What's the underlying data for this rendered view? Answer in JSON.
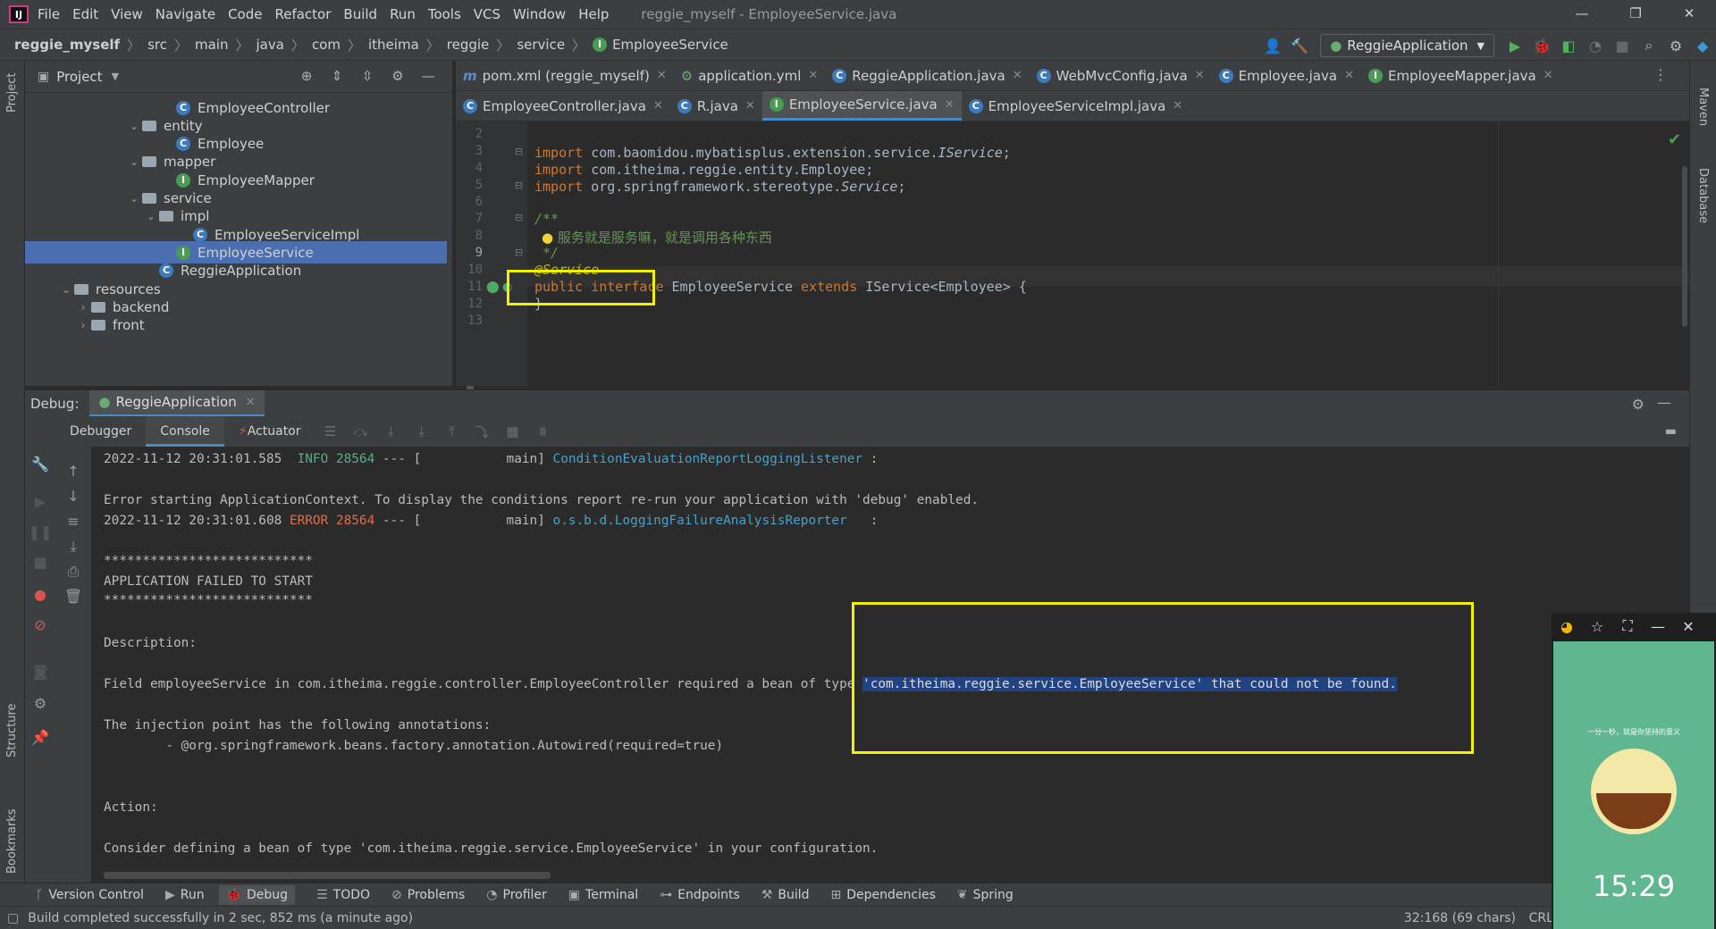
{
  "app": {
    "window_title": "reggie_myself - EmployeeService.java",
    "menu": [
      "File",
      "Edit",
      "View",
      "Navigate",
      "Code",
      "Refactor",
      "Build",
      "Run",
      "Tools",
      "VCS",
      "Window",
      "Help"
    ]
  },
  "breadcrumb": [
    "reggie_myself",
    "src",
    "main",
    "java",
    "com",
    "itheima",
    "reggie",
    "service",
    "EmployeeService"
  ],
  "run_config": "ReggieApplication",
  "project": {
    "title": "Project",
    "tree": [
      {
        "label": "EmployeeController",
        "icon": "class-icon",
        "indent": 9
      },
      {
        "label": "entity",
        "icon": "folder-icon",
        "indent": 7,
        "expanded": true
      },
      {
        "label": "Employee",
        "icon": "class-icon",
        "indent": 9
      },
      {
        "label": "mapper",
        "icon": "folder-icon",
        "indent": 7,
        "expanded": true
      },
      {
        "label": "EmployeeMapper",
        "icon": "interface-icon",
        "indent": 9
      },
      {
        "label": "service",
        "icon": "folder-icon",
        "indent": 7,
        "expanded": true
      },
      {
        "label": "impl",
        "icon": "folder-icon",
        "indent": 8,
        "expanded": true
      },
      {
        "label": "EmployeeServiceImpl",
        "icon": "class-icon",
        "indent": 10
      },
      {
        "label": "EmployeeService",
        "icon": "interface-icon",
        "indent": 9,
        "selected": true
      },
      {
        "label": "ReggieApplication",
        "icon": "class-icon",
        "indent": 8
      },
      {
        "label": "resources",
        "icon": "folder-icon",
        "indent": 3,
        "expanded": true
      },
      {
        "label": "backend",
        "icon": "folder-icon",
        "indent": 4,
        "collapsed": true
      },
      {
        "label": "front",
        "icon": "folder-icon",
        "indent": 4,
        "collapsed": true
      }
    ]
  },
  "editor": {
    "tabs_row1": [
      {
        "label": "pom.xml (reggie_myself)",
        "icon": "m"
      },
      {
        "label": "application.yml",
        "icon": "y"
      },
      {
        "label": "ReggieApplication.java",
        "icon": "c"
      },
      {
        "label": "WebMvcConfig.java",
        "icon": "c"
      },
      {
        "label": "Employee.java",
        "icon": "c"
      },
      {
        "label": "EmployeeMapper.java",
        "icon": "i"
      }
    ],
    "tabs_row2": [
      {
        "label": "EmployeeController.java",
        "icon": "c"
      },
      {
        "label": "R.java",
        "icon": "c"
      },
      {
        "label": "EmployeeService.java",
        "icon": "i",
        "active": true
      },
      {
        "label": "EmployeeServiceImpl.java",
        "icon": "c"
      }
    ],
    "line_numbers": [
      "2",
      "3",
      "4",
      "5",
      "6",
      "7",
      "8",
      "9",
      "10",
      "11",
      "12",
      "13"
    ],
    "code": {
      "l3_kw": "import ",
      "l3_pkg": "com.baomidou.mybatisplus.extension.service.",
      "l3_cls": "IService",
      "l3_end": ";",
      "l4_kw": "import ",
      "l4_rest": "com.itheima.reggie.entity.Employee;",
      "l5_kw": "import ",
      "l5_pkg": "org.springframework.stereotype.",
      "l5_cls": "Service",
      "l5_end": ";",
      "l7": "/**",
      "l8": "服务就是服务嘛，就是调用各种东西",
      "l9": " */",
      "l10": "@Service",
      "l11_kw1": "public interface ",
      "l11_name": "EmployeeService ",
      "l11_kw2": "extends ",
      "l11_rest": "IService<Employee> {",
      "l12": "}"
    }
  },
  "debug": {
    "label": "Debug:",
    "session_tab": "ReggieApplication",
    "tabs": [
      "Debugger",
      "Console",
      "Actuator"
    ],
    "console": {
      "l1_time": "2022-11-12 20:31:01.585  ",
      "l1_level": "INFO 28564",
      "l1_mid": " --- [           main] ",
      "l1_logger": "ConditionEvaluationReportLoggingListener",
      "l1_end": " :",
      "l2": "Error starting ApplicationContext. To display the conditions report re-run your application with 'debug' enabled.",
      "l3_time": "2022-11-12 20:31:01.608 ",
      "l3_level": "ERROR 28564",
      "l3_mid": " --- [           main] ",
      "l3_logger": "o.s.b.d.LoggingFailureAnalysisReporter",
      "l3_end": "   :",
      "stars": "***************************",
      "failed": "APPLICATION FAILED TO START",
      "desc": "Description:",
      "field_pre": "Field employeeService in com.itheima.reggie.controller.EmployeeController required a bean of type ",
      "field_hl": "'com.itheima.reggie.service.EmployeeService' that could not be found.",
      "inj": "The injection point has the following annotations:",
      "autowired": "\t- @org.springframework.beans.factory.annotation.Autowired(required=true)",
      "action": "Action:",
      "consider": "Consider defining a bean of type 'com.itheima.reggie.service.EmployeeService' in your configuration."
    }
  },
  "left_strip": [
    "Project",
    "Structure",
    "Bookmarks"
  ],
  "right_strip": [
    "Maven",
    "Database"
  ],
  "bottom_tabs": [
    "Version Control",
    "Run",
    "Debug",
    "TODO",
    "Problems",
    "Profiler",
    "Terminal",
    "Endpoints",
    "Build",
    "Dependencies",
    "Spring"
  ],
  "status": {
    "message": "Build completed successfully in 2 sec, 852 ms (a minute ago)",
    "position": "32:168 (69 chars)",
    "line_sep": "CRLF"
  },
  "phone": {
    "text1": "一分一秒，就是你坚持的意义",
    "clock": "15:29"
  },
  "colors": {
    "accent": "#4a88c7",
    "highlight_box": "#f2f200",
    "selection": "#4b6eaf"
  }
}
